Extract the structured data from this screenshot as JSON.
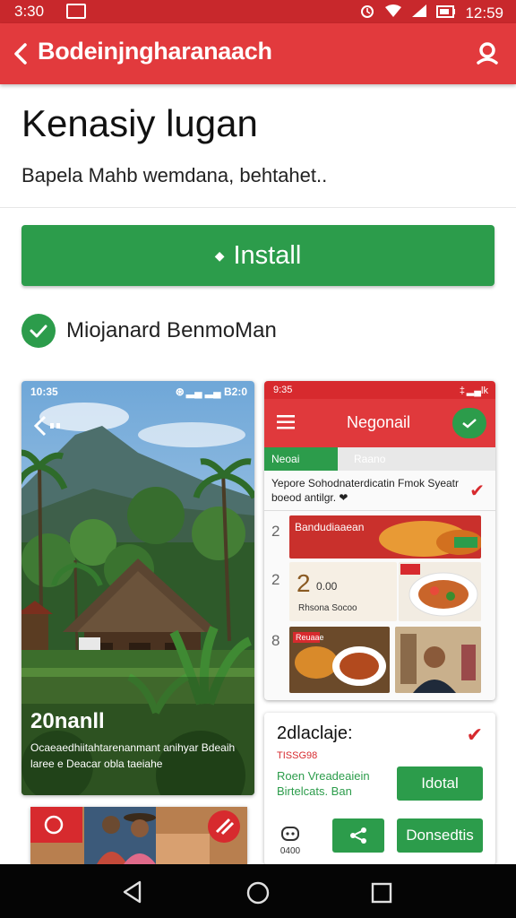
{
  "status_bar": {
    "time": "3:30",
    "box_label": "",
    "right_time": "12:59",
    "colors": {
      "bar": "#c8282c"
    }
  },
  "app_bar": {
    "title": "Bodeinjngharanaach",
    "back_icon": "chevron-left-icon",
    "action_icon": "location-icon",
    "color": "#e23a3d"
  },
  "app": {
    "name": "Kenasiy lugan",
    "subtitle": "Bapela Mahb wemdana, behtahet..",
    "install_label": "Install",
    "developer": "Miojanard BenmoMan",
    "accent": "#2c9c4b"
  },
  "screenshot1": {
    "status_time": "10:35",
    "status_right": "⊛ ▂▄ ▂▄ B2:0",
    "caption_title": "20nanll",
    "caption_text": "Ocaeaedhiitahtarenanmant anihyar Bdeaih laree e Deacar obla taeiahe"
  },
  "screenshot2": {
    "status_time": "9:35",
    "status_right": "‡ ▂▄lk",
    "title": "Negonail",
    "tab_active": "Neoai",
    "tab_inactive": "Raano",
    "description": "Yepore Sohodnaterdicatin Fmok Syeatr boeod antilgr. ❤",
    "rows": [
      {
        "num": "2",
        "label": "Bandudiaaean"
      },
      {
        "num": "2",
        "price_big": "2",
        "price_small": "0.00",
        "tag": "Rhsona Socoo"
      },
      {
        "num": "8",
        "label": "Reuaae"
      }
    ]
  },
  "screenshot3": {
    "title": "2dlaclaje:",
    "subtitle": "TISSG98",
    "description": "Roen Vreadeaiein Birtelcats. Ban",
    "install_label": "Idotal",
    "share_icon": "share-icon",
    "second_label": "Donsedtis",
    "icon_caption": "0400"
  },
  "nav": {
    "back_icon": "triangle-back-icon",
    "home_icon": "circle-home-icon",
    "recents_icon": "square-recents-icon"
  }
}
